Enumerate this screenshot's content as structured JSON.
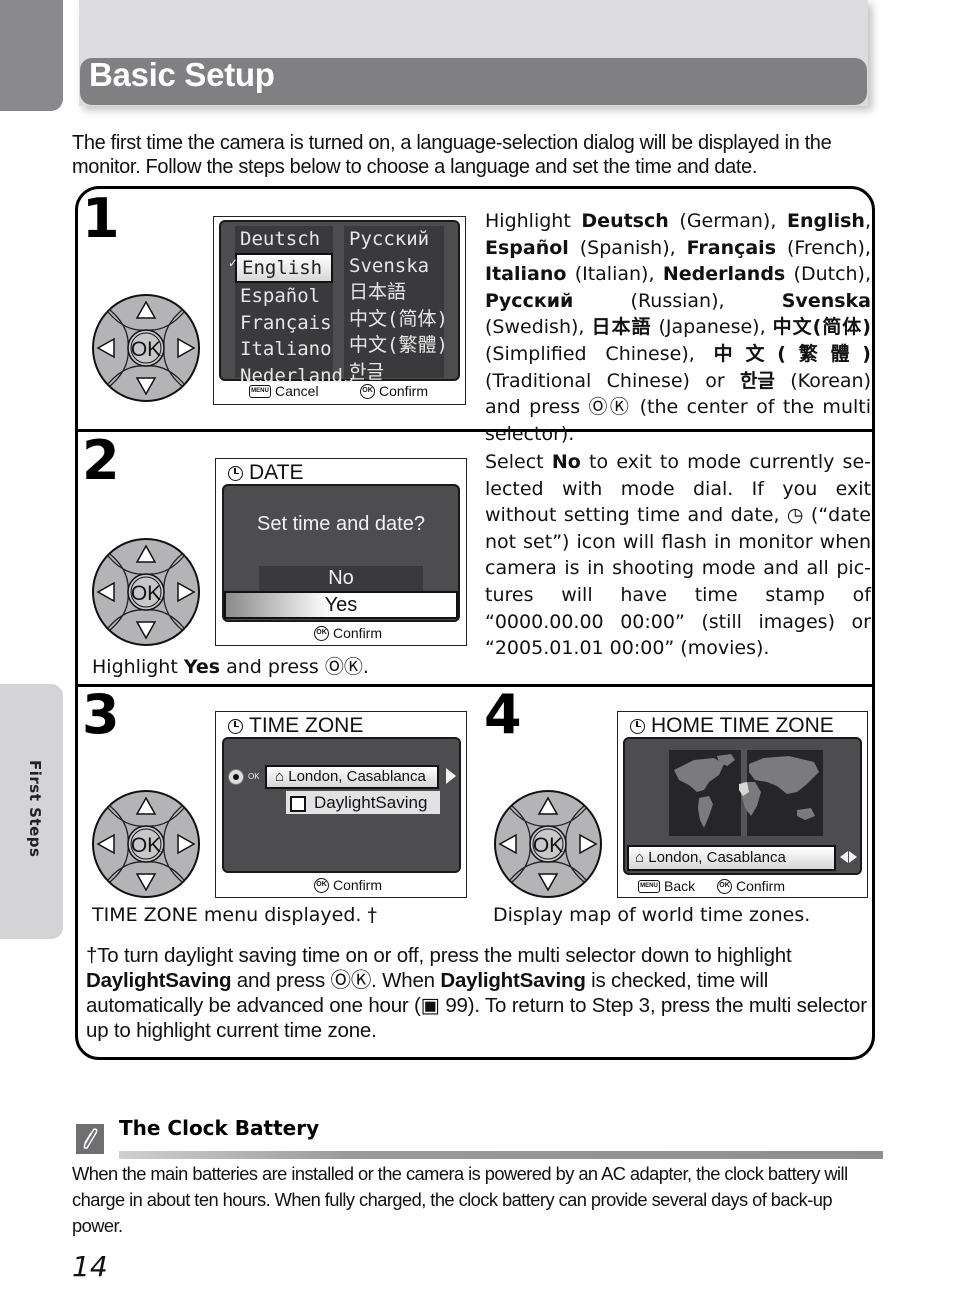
{
  "header": {
    "title": "Basic Setup",
    "side_tab_label": "First Steps"
  },
  "intro": "The first time the camera is turned on, a language-selection dialog will be displayed in the monitor. Follow the steps below to choose a language and set the time and date.",
  "steps": [
    {
      "number": "1",
      "screen": {
        "languages_left": [
          "Deutsch",
          "English",
          "Español",
          "Français",
          "Italiano",
          "Nederlands"
        ],
        "languages_right": [
          "Русский",
          "Svenska",
          "日本語",
          "中文(简体)",
          "中文(繁體)",
          "한글"
        ],
        "selected": "English",
        "checkmark": "✓",
        "footer_left": "Cancel",
        "footer_right": "Confirm",
        "menu_badge": "MENU",
        "ok_badge": "OK"
      },
      "description_parts": [
        {
          "t": "Highlight "
        },
        {
          "b": "Deutsch"
        },
        {
          "t": " (German), "
        },
        {
          "b": "English"
        },
        {
          "t": ", "
        },
        {
          "b": "Español"
        },
        {
          "t": " (Spanish), "
        },
        {
          "b": "Français"
        },
        {
          "t": " (French), "
        },
        {
          "b": "Italiano"
        },
        {
          "t": " (Italian), "
        },
        {
          "b": "Nederlands"
        },
        {
          "t": " (Dutch), "
        },
        {
          "b": "Русский"
        },
        {
          "t": " (Russian), "
        },
        {
          "b": "Svenska"
        },
        {
          "t": " (Swedish), "
        },
        {
          "b": "日本語"
        },
        {
          "t": " (Japanese), "
        },
        {
          "b": "中文(简体)"
        },
        {
          "t": " (Simplified Chinese), "
        },
        {
          "b": "中文(繁體)"
        },
        {
          "t": " (Traditional Chinese) or "
        },
        {
          "b": "한글"
        },
        {
          "t": " (Korean) and press ⓄⓀ (the center of the multi selector)."
        }
      ]
    },
    {
      "number": "2",
      "screen": {
        "title": "DATE",
        "prompt": "Set time and date?",
        "options": [
          "No",
          "Yes"
        ],
        "selected": "Yes",
        "footer_right": "Confirm",
        "ok_badge": "OK"
      },
      "caption_parts": [
        {
          "t": "Highlight "
        },
        {
          "b": "Yes"
        },
        {
          "t": " and press ⓄⓀ."
        }
      ],
      "description_parts": [
        {
          "t": "Select "
        },
        {
          "b": "No"
        },
        {
          "t": " to exit to mode currently se­lected with mode dial. If you exit without setting time and date, ◷ (“date not set”) icon will flash in monitor when camera is in shooting mode and all pic­tures will have time stamp of “0000.00.00 00:00” (still images) or “2005.01.01 00:00” (movies)."
        }
      ]
    },
    {
      "number": "3",
      "screen": {
        "title": "TIME ZONE",
        "zone": "London, Casablanca",
        "checkbox_label": "DaylightSaving",
        "checkbox_checked": false,
        "ok_small": "OK",
        "footer_right": "Confirm",
        "ok_badge": "OK"
      },
      "caption": "TIME ZONE menu displayed. †"
    },
    {
      "number": "4",
      "screen": {
        "title": "HOME TIME ZONE",
        "zone": "London, Casablanca",
        "footer_left": "Back",
        "footer_right": "Confirm",
        "menu_badge": "MENU",
        "ok_badge": "OK"
      },
      "caption": "Display map of world time zones."
    }
  ],
  "selector": {
    "center_label": "OK"
  },
  "footnote_parts": [
    {
      "t": "†To turn daylight saving time on or off, press the multi selector down to high­light "
    },
    {
      "b": "DaylightSaving"
    },
    {
      "t": " and press ⓄⓀ. When "
    },
    {
      "b": "DaylightSaving"
    },
    {
      "t": " is checked, time will automatically be advanced one hour (▣ 99). To return to Step 3, press the multi selector up to highlight current time zone."
    }
  ],
  "note": {
    "title": "The Clock Battery",
    "body": "When the main batteries are installed or the camera is powered by an AC adapter, the clock battery will charge in about ten hours. When fully charged, the clock battery can provide several days of back-up power."
  },
  "page_number": "14"
}
